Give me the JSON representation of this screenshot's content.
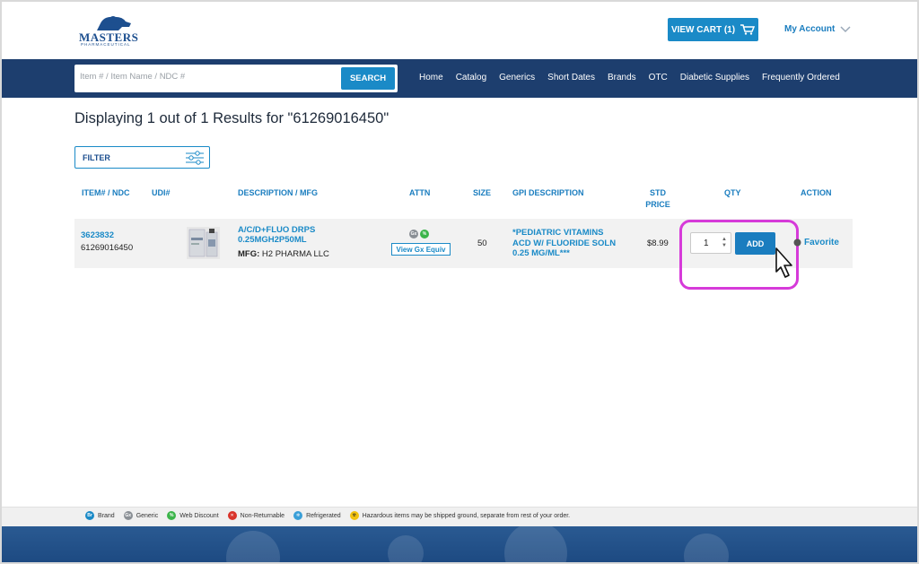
{
  "header": {
    "logo_text": "MASTERS",
    "logo_sub": "PHARMACEUTICAL",
    "cart_label": "VIEW CART (1)",
    "account_label": "My Account"
  },
  "search": {
    "placeholder": "Item # / Item Name / NDC #",
    "button_label": "SEARCH"
  },
  "nav": [
    "Home",
    "Catalog",
    "Generics",
    "Short Dates",
    "Brands",
    "OTC",
    "Diabetic Supplies",
    "Frequently Ordered"
  ],
  "results": {
    "title": "Displaying 1 out of 1 Results for \"61269016450\""
  },
  "filter": {
    "label": "FILTER"
  },
  "table": {
    "headers": {
      "item_ndc": "ITEM# / NDC",
      "udi": "UDI#",
      "description": "DESCRIPTION / MFG",
      "attn": "ATTN",
      "size": "SIZE",
      "gpi": "GPI DESCRIPTION",
      "std_price_1": "STD",
      "std_price_2": "PRICE",
      "qty": "QTY",
      "action": "ACTION"
    },
    "row": {
      "item_number": "3623832",
      "ndc": "61269016450",
      "desc_line1": "A/C/D+FLUO DRPS",
      "desc_line2": "0.25MGH2P50ML",
      "mfg_label": "MFG:",
      "mfg_value": "H2 PHARMA LLC",
      "gx_button": "View Gx Equiv",
      "size": "50",
      "gpi_line1": "*PEDIATRIC VITAMINS",
      "gpi_line2": "ACD W/ FLUORIDE SOLN",
      "gpi_line3": "0.25 MG/ML***",
      "price": "$8.99",
      "qty": "1",
      "add_label": "ADD",
      "favorite_label": "Favorite"
    }
  },
  "legend": {
    "brand": "Brand",
    "generic": "Generic",
    "web_discount": "Web Discount",
    "non_returnable": "Non-Returnable",
    "refrigerated": "Refrigerated",
    "hazardous": "Hazardous items may be shipped ground, separate from rest of your order."
  },
  "colors": {
    "navy": "#1d3e6e",
    "accent": "#1a8ac7",
    "highlight": "#d63ad9"
  }
}
